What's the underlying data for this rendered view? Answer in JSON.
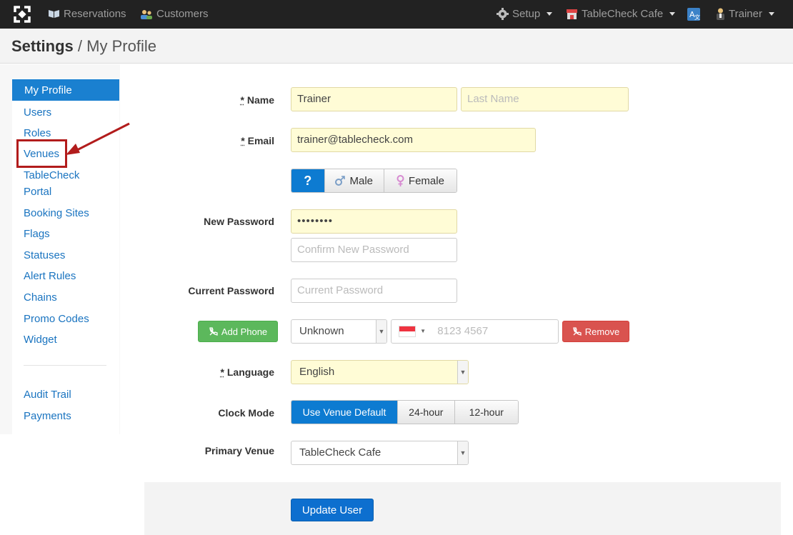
{
  "nav": {
    "reservations": "Reservations",
    "customers": "Customers",
    "setup": "Setup",
    "venue": "TableCheck Cafe",
    "user": "Trainer"
  },
  "header": {
    "section": "Settings",
    "separator": "/",
    "page": "My Profile"
  },
  "sidebar": {
    "active": "My Profile",
    "items": [
      "Users",
      "Roles",
      "Venues",
      "TableCheck",
      "Portal",
      "Booking Sites",
      "Flags",
      "Statuses",
      "Alert Rules",
      "Chains",
      "Promo Codes",
      "Widget"
    ],
    "secondary": [
      "Audit Trail",
      "Payments"
    ]
  },
  "form": {
    "name_label": "Name",
    "required_mark": "*",
    "first_name": "Trainer",
    "last_name_placeholder": "Last Name",
    "email_label": "Email",
    "email": "trainer@tablecheck.com",
    "gender": {
      "unknown": "?",
      "male": "Male",
      "female": "Female",
      "selected": "?"
    },
    "new_password_label": "New Password",
    "new_password": "••••••••",
    "confirm_password_placeholder": "Confirm New Password",
    "current_password_label": "Current Password",
    "current_password_placeholder": "Current Password",
    "add_phone": "Add Phone",
    "phone_type": "Unknown",
    "phone_placeholder": "8123 4567",
    "remove": "Remove",
    "language_label": "Language",
    "language": "English",
    "clock_label": "Clock Mode",
    "clock_options": [
      "Use Venue Default",
      "24-hour",
      "12-hour"
    ],
    "clock_selected": "Use Venue Default",
    "venue_label": "Primary Venue",
    "venue": "TableCheck Cafe",
    "submit": "Update User"
  },
  "colors": {
    "navbar": "#222222",
    "accent": "#1a80d0",
    "success": "#4cae4c",
    "danger": "#d9403a",
    "annotation": "#b21c1c"
  }
}
